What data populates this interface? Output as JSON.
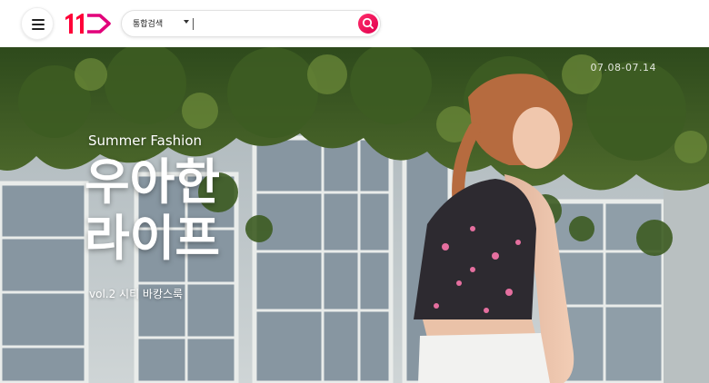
{
  "header": {
    "menu_icon": "hamburger-menu-icon",
    "logo_text": "11",
    "logo_colors": {
      "one": "#ff0038",
      "arrow": "#e2007a"
    },
    "search": {
      "scope_label": "통합검색",
      "placeholder": "",
      "value": "",
      "button_icon": "search-icon",
      "button_color": "#ec0a5b"
    }
  },
  "hero": {
    "date_range": "07.08-07.14",
    "subtitle": "Summer Fashion",
    "title_line1": "우아한",
    "title_line2": "라이프",
    "caption": "vol.2 시티 바캉스룩"
  }
}
